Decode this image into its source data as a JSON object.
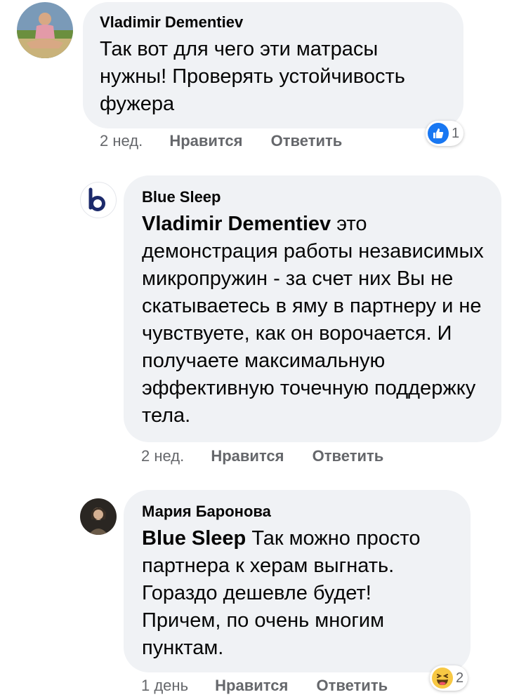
{
  "comments": [
    {
      "author": "Vladimir Dementiev",
      "text": "Так вот для чего эти матрасы нужны! Проверять устойчивость фужера",
      "time": "2 нед.",
      "like_label": "Нравится",
      "reply_label": "Ответить",
      "reaction_count": "1",
      "reaction_icon": "like-icon"
    },
    {
      "author": "Blue Sleep",
      "avatar_letter": "b",
      "mention": "Vladimir Dementiev",
      "text": " это демонстрация работы независимых микропружин - за счет них Вы не скатываетесь в яму в партнеру и не чувствуете, как он ворочается. И получаете максимальную эффективную точечную поддержку тела.",
      "time": "2 нед.",
      "like_label": "Нравится",
      "reply_label": "Ответить"
    },
    {
      "author": "Мария Баронова",
      "mention": "Blue Sleep",
      "text": " Так можно просто партнера к херам выгнать. Гораздо дешевле будет! Причем, по очень многим пунктам.",
      "time": "1 день",
      "like_label": "Нравится",
      "reply_label": "Ответить",
      "reaction_count": "2",
      "reaction_icon": "haha-icon"
    }
  ],
  "colors": {
    "bubble": "#f0f2f5",
    "meta": "#65676b",
    "like_blue": "#1877f2",
    "brand_navy": "#1c2a6b"
  }
}
